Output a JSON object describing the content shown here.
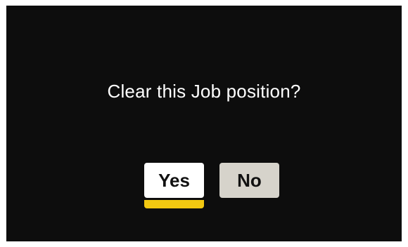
{
  "dialog": {
    "message": "Clear this Job position?",
    "buttons": {
      "yes_label": "Yes",
      "no_label": "No"
    },
    "focused_button": "Yes"
  },
  "colors": {
    "background": "#0d0d0d",
    "text": "#ffffff",
    "yes_button_bg": "#ffffff",
    "no_button_bg": "#d6d3cb",
    "focus_accent": "#f2c811"
  }
}
